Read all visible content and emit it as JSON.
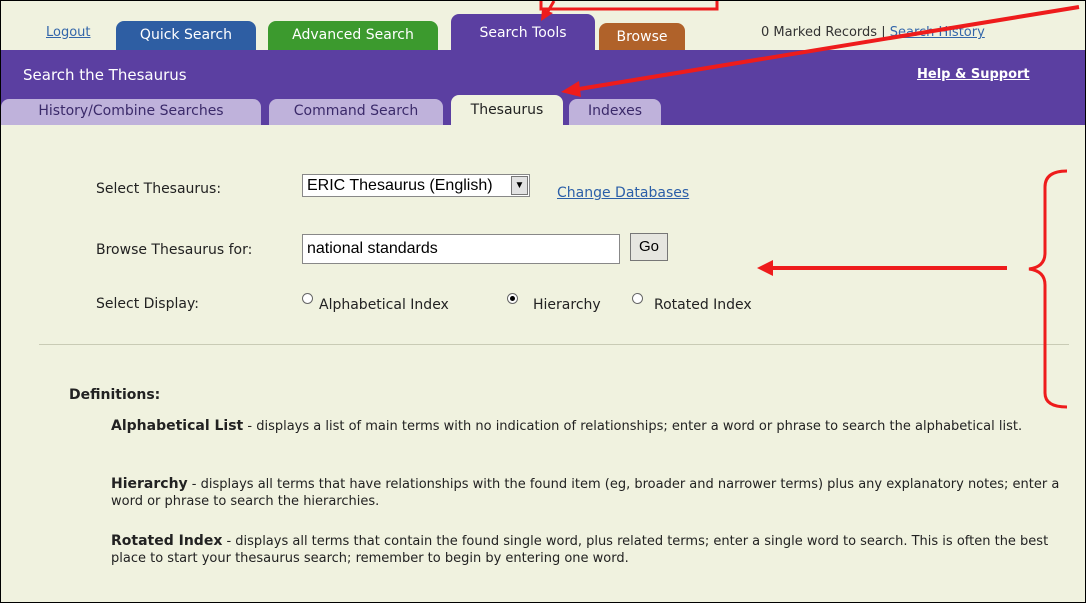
{
  "top_nav": {
    "logout": "Logout",
    "tabs": [
      {
        "label": "Quick Search"
      },
      {
        "label": "Advanced Search"
      },
      {
        "label": "Search Tools"
      },
      {
        "label": "Browse"
      }
    ],
    "marked_records": "0 Marked Records",
    "separator": "|",
    "search_history": "Search History"
  },
  "header": {
    "title": "Search the Thesaurus",
    "help": "Help & Support"
  },
  "sub_tabs": [
    {
      "label": "History/Combine Searches"
    },
    {
      "label": "Command Search"
    },
    {
      "label": "Thesaurus"
    },
    {
      "label": "Indexes"
    }
  ],
  "form": {
    "select_label": "Select Thesaurus:",
    "select_value": "ERIC Thesaurus (English)",
    "change_databases": "Change Databases",
    "browse_label": "Browse Thesaurus for:",
    "browse_value": "national standards",
    "go_label": "Go",
    "display_label": "Select Display:",
    "display_options": [
      {
        "label": "Alphabetical Index",
        "selected": false
      },
      {
        "label": "Hierarchy",
        "selected": true
      },
      {
        "label": "Rotated Index",
        "selected": false
      }
    ]
  },
  "definitions": {
    "heading": "Definitions:",
    "items": [
      {
        "term": "Alphabetical List",
        "text": " - displays a list of main terms with no indication of relationships; enter a word or phrase to search the alphabetical list."
      },
      {
        "term": "Hierarchy",
        "text": " - displays all terms that have relationships with the found item (eg, broader and narrower terms) plus any explanatory notes; enter a word or phrase to search the hierarchies."
      },
      {
        "term": "Rotated Index",
        "text": " - displays all terms that contain the found single word, plus related terms; enter a single word to search. This is often the best place to start your thesaurus search; remember to begin by entering one word."
      }
    ]
  },
  "colors": {
    "page_bg": "#f0f2df",
    "header_purple": "#5b3fa1",
    "quick_search_tab": "#2e5ea3",
    "advanced_search_tab": "#3c9a2e",
    "browse_tab": "#b0622a",
    "annotation_red": "#ee1c1c"
  }
}
